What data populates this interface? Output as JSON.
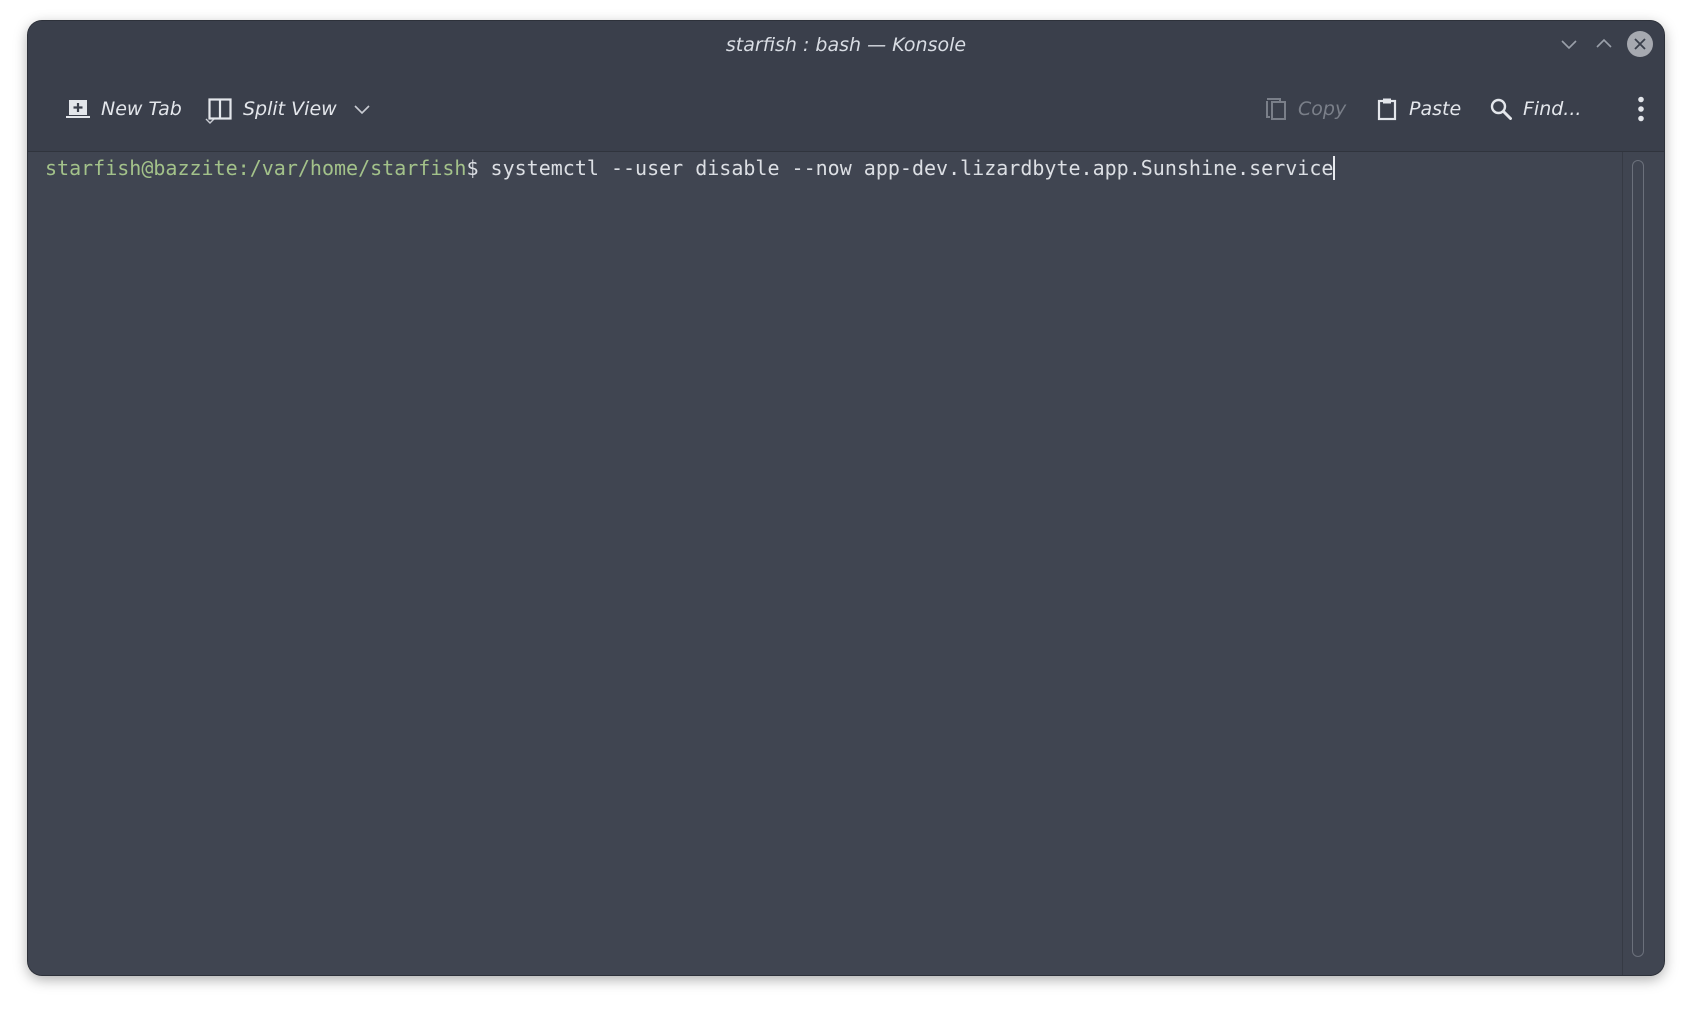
{
  "window": {
    "title": "starfish : bash — Konsole"
  },
  "toolbar": {
    "new_tab": "New Tab",
    "split_view": "Split View",
    "copy": "Copy",
    "paste": "Paste",
    "find": "Find..."
  },
  "terminal": {
    "prompt": "starfish@bazzite:/var/home/starfish",
    "prompt_symbol": "$ ",
    "command": "systemctl --user disable --now app-dev.lizardbyte.app.Sunshine.service"
  },
  "icons": {
    "new_tab": "new-tab-icon",
    "split_view": "split-view-icon",
    "copy": "copy-icon",
    "paste": "paste-icon",
    "find": "search-icon",
    "menu": "kebab-menu-icon",
    "minimize": "chevron-down-icon",
    "maximize": "chevron-up-icon",
    "close": "close-icon"
  },
  "colors": {
    "background": "#404551",
    "prompt": "#a3c28a",
    "text": "#dcdfe4"
  }
}
